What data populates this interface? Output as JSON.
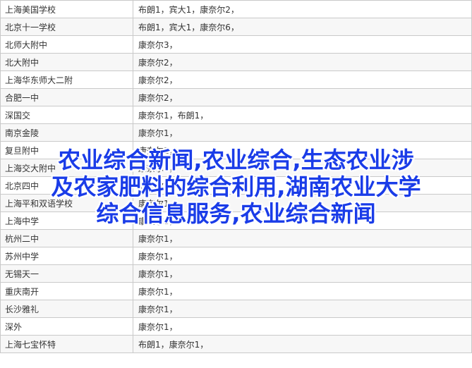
{
  "table": {
    "rows": [
      {
        "school": "上海美国学校",
        "awards": "布朗1，宾大1，康奈尔2，"
      },
      {
        "school": "北京十一学校",
        "awards": "布朗1，宾大1，康奈尔6，"
      },
      {
        "school": "北师大附中",
        "awards": "康奈尔3，"
      },
      {
        "school": "北大附中",
        "awards": "康奈尔2，"
      },
      {
        "school": "上海华东师大二附",
        "awards": "康奈尔2，"
      },
      {
        "school": "合肥一中",
        "awards": "康奈尔2，"
      },
      {
        "school": "深国交",
        "awards": "康奈尔1，布朗1，"
      },
      {
        "school": "南京金陵",
        "awards": "康奈尔1，"
      },
      {
        "school": "复旦附中",
        "awards": "康奈尔1，"
      },
      {
        "school": "上海交大附中",
        "awards": "康奈尔1，"
      },
      {
        "school": "北京四中",
        "awards": "康奈尔1，"
      },
      {
        "school": "上海平和双语学校",
        "awards": "康奈尔1，"
      },
      {
        "school": "上海中学",
        "awards": "康奈尔1，"
      },
      {
        "school": "杭州二中",
        "awards": "康奈尔1，"
      },
      {
        "school": "苏州中学",
        "awards": "康奈尔1，"
      },
      {
        "school": "无锡天一",
        "awards": "康奈尔1，"
      },
      {
        "school": "重庆南开",
        "awards": "康奈尔1，"
      },
      {
        "school": "长沙雅礼",
        "awards": "康奈尔1，"
      },
      {
        "school": "深外",
        "awards": "康奈尔1，"
      },
      {
        "school": "上海七宝怀特",
        "awards": "布朗1，康奈尔1，"
      }
    ]
  },
  "overlay": {
    "line1": "农业综合新闻,农业综合,生态农业涉",
    "line2": "及农家肥料的综合利用,湖南农业大学",
    "line3": "综合信息服务,农业综合新闻"
  },
  "colors": {
    "overlay_text": "#1a3ce8",
    "grid": "#c9c9c9"
  }
}
